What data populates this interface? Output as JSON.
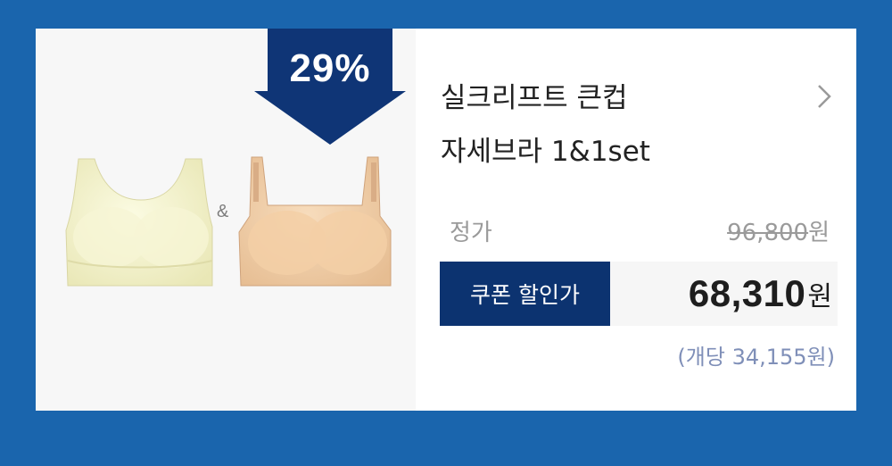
{
  "discount": {
    "rate": "29%"
  },
  "product": {
    "title_line1": "실크리프트 큰컵",
    "title_line2": "자세브라 1&1set",
    "separator": "&"
  },
  "pricing": {
    "regular_label": "정가",
    "regular_value": "96,800",
    "currency": "원",
    "coupon_label": "쿠폰 할인가",
    "sale_value": "68,310",
    "per_unit": "(개당 34,155원)"
  },
  "colors": {
    "background": "#1a65ad",
    "badge": "#0f3576",
    "coupon_label_bg": "#0c3370",
    "product_1": "#f4f3cc",
    "product_2": "#f1cfa9"
  },
  "icons": {
    "more": "chevron-right-icon",
    "badge": "arrow-down-badge"
  }
}
